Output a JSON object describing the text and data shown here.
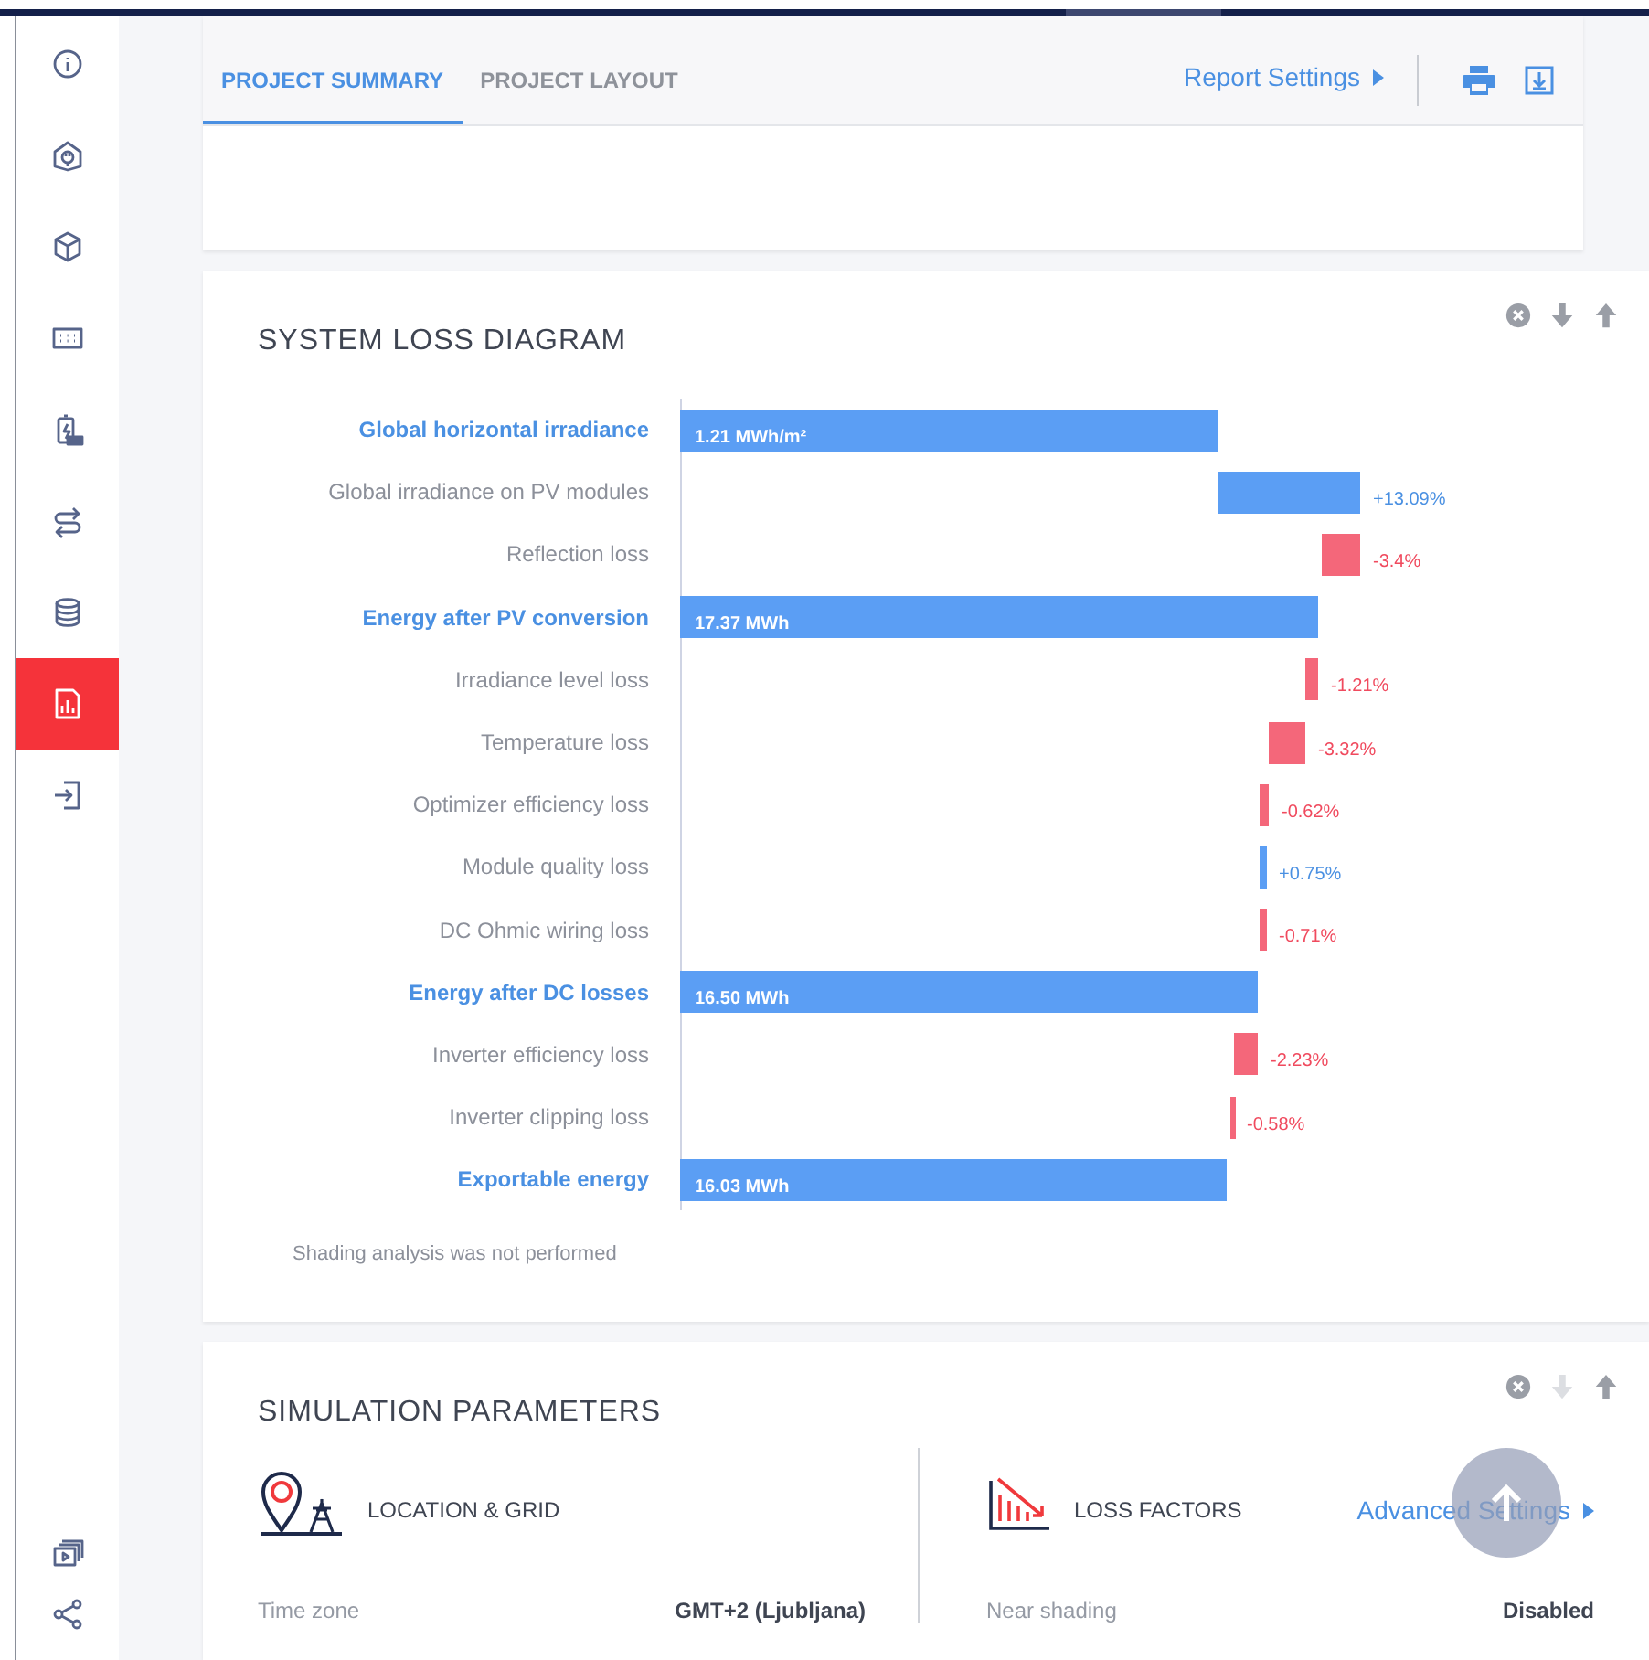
{
  "sidebar": {
    "items": [
      {
        "selected": false
      },
      {
        "selected": false
      },
      {
        "selected": false
      },
      {
        "selected": false
      },
      {
        "selected": false
      },
      {
        "selected": false
      },
      {
        "selected": false
      },
      {
        "selected": true
      },
      {
        "selected": false
      }
    ]
  },
  "header": {
    "tabs": [
      {
        "label": "PROJECT SUMMARY",
        "selected": true
      },
      {
        "label": "PROJECT LAYOUT",
        "selected": false
      }
    ],
    "report_settings": "Report Settings"
  },
  "loss_panel": {
    "title": "SYSTEM LOSS DIAGRAM",
    "controls": [
      {
        "kind": "close",
        "disabled": false
      },
      {
        "kind": "down",
        "disabled": false
      },
      {
        "kind": "up",
        "disabled": false
      }
    ],
    "rows": [
      {
        "label": "Global horizontal irradiance",
        "kind": "total",
        "value": "1.21 MWh/m²"
      },
      {
        "label": "Global irradiance on PV modules",
        "kind": "gain",
        "value": "+13.09%"
      },
      {
        "label": "Reflection loss",
        "kind": "loss",
        "value": "-3.4%"
      },
      {
        "label": "Energy after PV conversion",
        "kind": "total",
        "value": "17.37 MWh"
      },
      {
        "label": "Irradiance level loss",
        "kind": "loss",
        "value": "-1.21%"
      },
      {
        "label": "Temperature loss",
        "kind": "loss",
        "value": "-3.32%"
      },
      {
        "label": "Optimizer efficiency loss",
        "kind": "loss",
        "value": "-0.62%"
      },
      {
        "label": "Module quality loss",
        "kind": "gain",
        "value": "+0.75%"
      },
      {
        "label": "DC Ohmic wiring loss",
        "kind": "loss",
        "value": "-0.71%"
      },
      {
        "label": "Energy after DC losses",
        "kind": "total",
        "value": "16.50 MWh"
      },
      {
        "label": "Inverter efficiency loss",
        "kind": "loss",
        "value": "-2.23%"
      },
      {
        "label": "Inverter clipping loss",
        "kind": "loss",
        "value": "-0.58%"
      },
      {
        "label": "Exportable energy",
        "kind": "total",
        "value": "16.03 MWh"
      }
    ],
    "note": "Shading analysis was not performed"
  },
  "sim_panel": {
    "title": "SIMULATION PARAMETERS",
    "controls": [
      {
        "kind": "close",
        "disabled": false
      },
      {
        "kind": "down",
        "disabled": true
      },
      {
        "kind": "up",
        "disabled": false
      }
    ],
    "sections": [
      {
        "title": "LOCATION & GRID",
        "rows": [
          {
            "label": "Time zone",
            "value": "GMT+2 (Ljubljana)"
          }
        ]
      },
      {
        "title": "LOSS FACTORS",
        "link": "Advanced Settings",
        "rows": [
          {
            "label": "Near shading",
            "value": "Disabled"
          }
        ]
      }
    ]
  }
}
